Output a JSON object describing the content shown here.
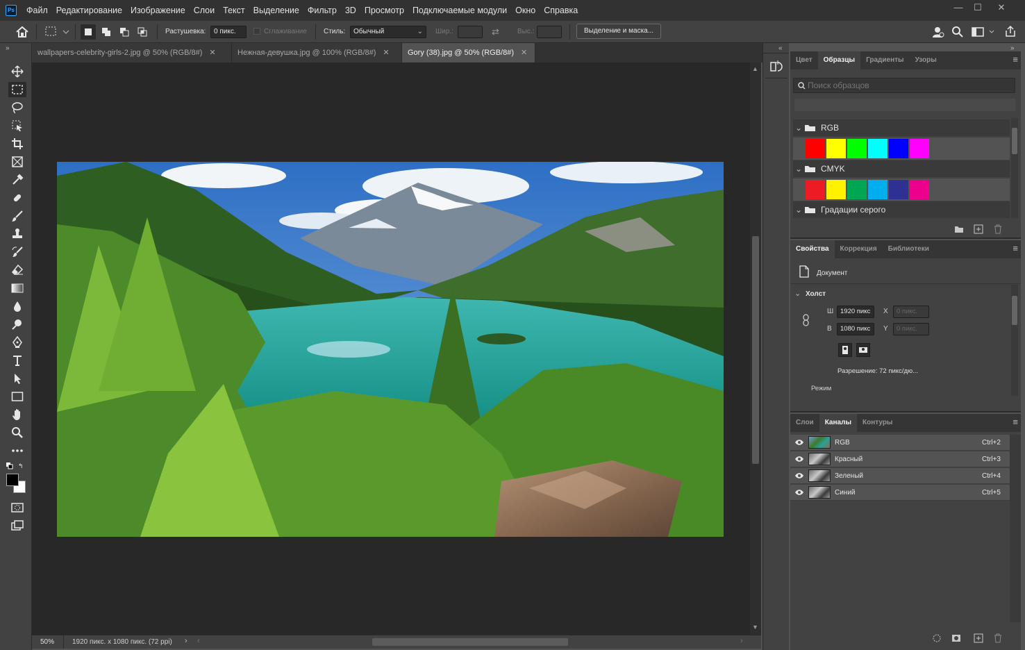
{
  "menubar": {
    "logo": "Ps",
    "items": [
      "Файл",
      "Редактирование",
      "Изображение",
      "Слои",
      "Текст",
      "Выделение",
      "Фильтр",
      "3D",
      "Просмотр",
      "Подключаемые модули",
      "Окно",
      "Справка"
    ],
    "minimize": "—",
    "maximize": "☐",
    "close": "✕"
  },
  "options": {
    "feather_label": "Растушевка:",
    "feather_value": "0 пикс.",
    "antialias_label": "Сглаживание",
    "style_label": "Стиль:",
    "style_value": "Обычный",
    "width_label": "Шир.:",
    "height_label": "Выс.:",
    "select_mask_button": "Выделение и маска..."
  },
  "tabs": [
    {
      "label": "wallpapers-celebrity-girls-2.jpg @ 50% (RGB/8#)",
      "active": false
    },
    {
      "label": "Нежная-девушка.jpg @ 100% (RGB/8#)",
      "active": false
    },
    {
      "label": "Gory (38).jpg @ 50% (RGB/8#)",
      "active": true
    }
  ],
  "status": {
    "zoom": "50%",
    "doc_info": "1920 пикс. x 1080 пикс. (72 ppi)"
  },
  "swatches_panel": {
    "tabs": [
      "Цвет",
      "Образцы",
      "Градиенты",
      "Узоры"
    ],
    "active_tab": "Образцы",
    "search_placeholder": "Поиск образцов",
    "groups": [
      {
        "name": "RGB",
        "colors": [
          "#ff0000",
          "#ffff00",
          "#00ff00",
          "#00ffff",
          "#0000ff",
          "#ff00ff"
        ]
      },
      {
        "name": "CMYK",
        "colors": [
          "#ed1c24",
          "#fff200",
          "#00a651",
          "#00aeef",
          "#2e3192",
          "#ec008c"
        ]
      },
      {
        "name": "Градации серого",
        "colors": []
      }
    ]
  },
  "properties_panel": {
    "tabs": [
      "Свойства",
      "Коррекция",
      "Библиотеки"
    ],
    "active_tab": "Свойства",
    "doc_label": "Документ",
    "canvas_section": "Холст",
    "w_label": "Ш",
    "w_value": "1920 пикс",
    "h_label": "В",
    "h_value": "1080 пикс",
    "x_label": "X",
    "x_placeholder": "0 пикс.",
    "y_label": "Y",
    "y_placeholder": "0 пикс.",
    "resolution": "Разрешение: 72 пикс/дю...",
    "mode_label": "Режим"
  },
  "channels_panel": {
    "tabs": [
      "Слои",
      "Каналы",
      "Контуры"
    ],
    "active_tab": "Каналы",
    "channels": [
      {
        "name": "RGB",
        "shortcut": "Ctrl+2"
      },
      {
        "name": "Красный",
        "shortcut": "Ctrl+3"
      },
      {
        "name": "Зеленый",
        "shortcut": "Ctrl+4"
      },
      {
        "name": "Синий",
        "shortcut": "Ctrl+5"
      }
    ]
  },
  "colors": {
    "foreground": "#000000",
    "background": "#ffffff",
    "accent": "#31a8ff"
  }
}
